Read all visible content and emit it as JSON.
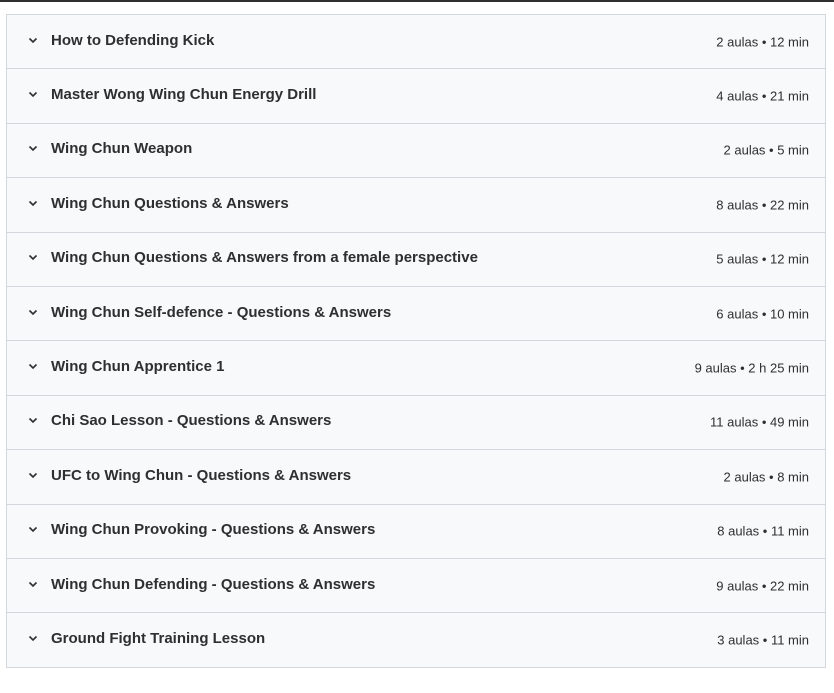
{
  "sections": [
    {
      "title": "How to Defending Kick",
      "meta": "2 aulas • 12 min"
    },
    {
      "title": "Master Wong Wing Chun Energy Drill",
      "meta": "4 aulas • 21 min"
    },
    {
      "title": "Wing Chun Weapon",
      "meta": "2 aulas • 5 min"
    },
    {
      "title": "Wing Chun Questions & Answers",
      "meta": "8 aulas • 22 min"
    },
    {
      "title": "Wing Chun Questions & Answers from a female perspective",
      "meta": "5 aulas • 12 min"
    },
    {
      "title": "Wing Chun Self-defence - Questions & Answers",
      "meta": "6 aulas • 10 min"
    },
    {
      "title": "Wing Chun Apprentice 1",
      "meta": "9 aulas • 2 h 25 min"
    },
    {
      "title": "Chi Sao Lesson - Questions & Answers",
      "meta": "11 aulas • 49 min"
    },
    {
      "title": "UFC to Wing Chun - Questions & Answers",
      "meta": "2 aulas • 8 min"
    },
    {
      "title": "Wing Chun Provoking - Questions & Answers",
      "meta": "8 aulas • 11 min"
    },
    {
      "title": "Wing Chun Defending - Questions & Answers",
      "meta": "9 aulas • 22 min"
    },
    {
      "title": "Ground Fight Training Lesson",
      "meta": "3 aulas • 11 min"
    }
  ],
  "icons": {
    "toggle": "chevron-down-icon"
  },
  "colors": {
    "text": "#2d2f31",
    "panel_bg": "#f7f9fa",
    "border": "#d1d7dc"
  }
}
